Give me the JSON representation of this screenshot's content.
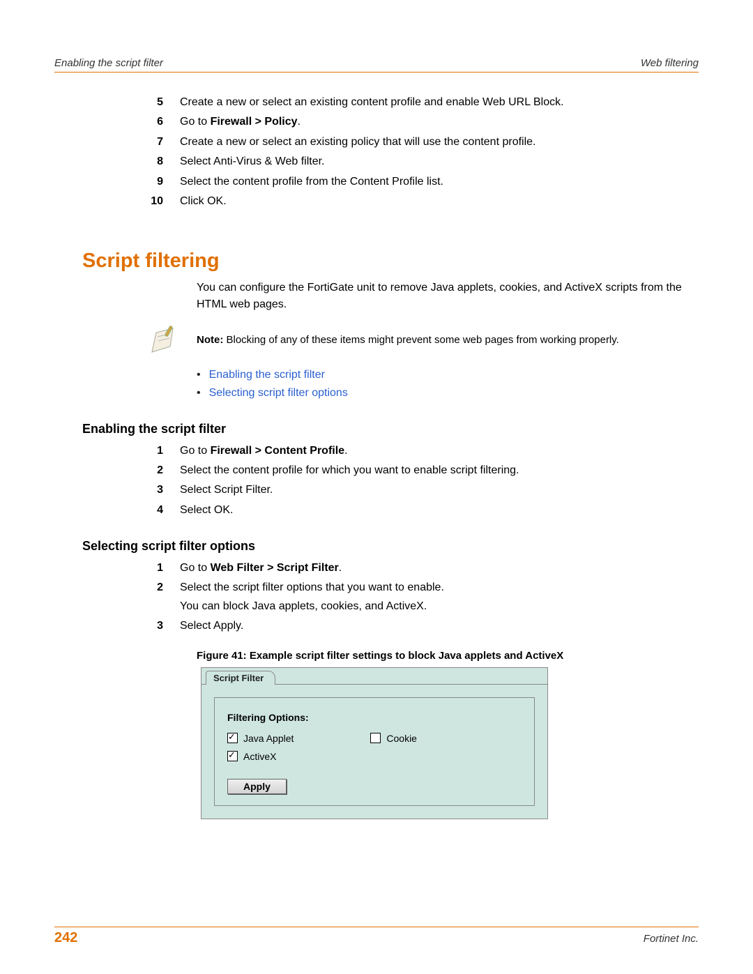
{
  "header": {
    "left": "Enabling the script filter",
    "right": "Web filtering"
  },
  "footer": {
    "page": "242",
    "company": "Fortinet Inc."
  },
  "steps_top": [
    {
      "n": "5",
      "pre": "",
      "strong": "",
      "post": "Create a new or select an existing content profile and enable Web URL Block."
    },
    {
      "n": "6",
      "pre": "Go to ",
      "strong": "Firewall > Policy",
      "post": "."
    },
    {
      "n": "7",
      "pre": "",
      "strong": "",
      "post": "Create a new or select an existing policy that will use the content profile."
    },
    {
      "n": "8",
      "pre": "",
      "strong": "",
      "post": "Select Anti-Virus & Web filter."
    },
    {
      "n": "9",
      "pre": "",
      "strong": "",
      "post": "Select the content profile from the Content Profile list."
    },
    {
      "n": "10",
      "pre": "",
      "strong": "",
      "post": "Click OK."
    }
  ],
  "h1": "Script filtering",
  "intro": "You can configure the FortiGate unit to remove Java applets, cookies, and ActiveX scripts from the HTML web pages.",
  "note": {
    "label": "Note: ",
    "text": "Blocking of any of these items might prevent some web pages from working properly."
  },
  "toc": [
    "Enabling the script filter",
    "Selecting script filter options"
  ],
  "sec1": {
    "title": "Enabling the script filter",
    "steps": [
      {
        "n": "1",
        "pre": "Go to ",
        "strong": "Firewall > Content Profile",
        "post": "."
      },
      {
        "n": "2",
        "pre": "",
        "strong": "",
        "post": "Select the content profile for which you want to enable script filtering."
      },
      {
        "n": "3",
        "pre": "",
        "strong": "",
        "post": "Select Script Filter."
      },
      {
        "n": "4",
        "pre": "",
        "strong": "",
        "post": "Select OK."
      }
    ]
  },
  "sec2": {
    "title": "Selecting script filter options",
    "steps": [
      {
        "n": "1",
        "pre": "Go to ",
        "strong": "Web Filter > Script Filter",
        "post": "."
      },
      {
        "n": "2",
        "pre": "",
        "strong": "",
        "post": "Select the script filter options that you want to enable.",
        "post2": "You can block Java applets, cookies, and ActiveX."
      },
      {
        "n": "3",
        "pre": "",
        "strong": "",
        "post": "Select Apply."
      }
    ]
  },
  "figure": {
    "caption": "Figure 41: Example script filter settings to block Java applets and ActiveX",
    "tab": "Script Filter",
    "legend": "Filtering Options:",
    "opt_java": "Java Applet",
    "opt_cookie": "Cookie",
    "opt_activex": "ActiveX",
    "apply": "Apply"
  }
}
